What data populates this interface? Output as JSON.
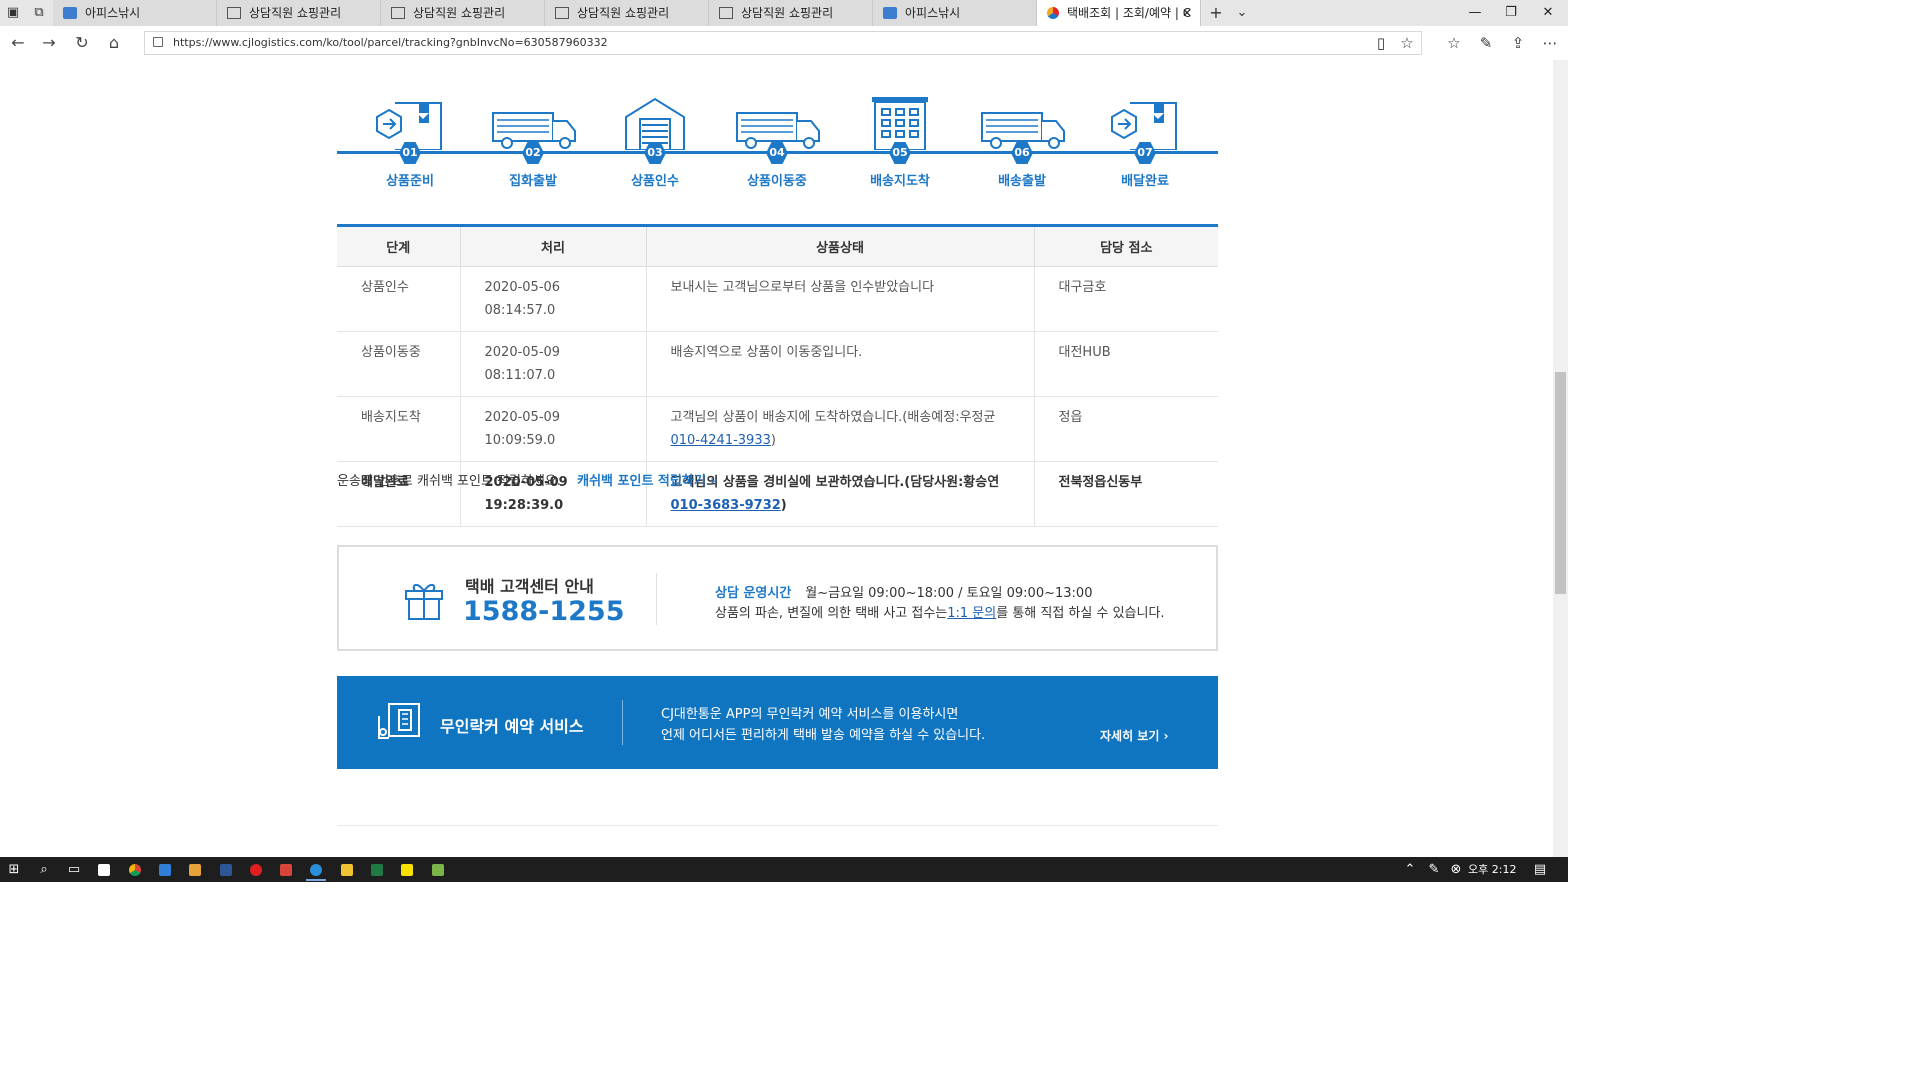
{
  "browser": {
    "tabs": [
      {
        "title": "아피스낚시",
        "icon": "tc",
        "active": false
      },
      {
        "title": "상담직원 쇼핑관리",
        "icon": "page",
        "active": false
      },
      {
        "title": "상담직원 쇼핑관리",
        "icon": "page",
        "active": false
      },
      {
        "title": "상담직원 쇼핑관리",
        "icon": "page",
        "active": false
      },
      {
        "title": "상담직원 쇼핑관리",
        "icon": "page",
        "active": false
      },
      {
        "title": "아피스낚시",
        "icon": "tc",
        "active": false
      },
      {
        "title": "택배조회 | 조회/예약 | C",
        "icon": "cj",
        "active": true
      }
    ],
    "url": "https://www.cjlogistics.com/ko/tool/parcel/tracking?gnbInvcNo=630587960332"
  },
  "steps": [
    {
      "num": "01",
      "label": "상품준비",
      "icon": "box"
    },
    {
      "num": "02",
      "label": "집화출발",
      "icon": "truck"
    },
    {
      "num": "03",
      "label": "상품인수",
      "icon": "warehouse"
    },
    {
      "num": "04",
      "label": "상품이동중",
      "icon": "truck"
    },
    {
      "num": "05",
      "label": "배송지도착",
      "icon": "building"
    },
    {
      "num": "06",
      "label": "배송출발",
      "icon": "truck"
    },
    {
      "num": "07",
      "label": "배달완료",
      "icon": "box"
    }
  ],
  "table": {
    "headers": [
      "단계",
      "처리",
      "상품상태",
      "담당 점소"
    ],
    "rows": [
      {
        "stage": "상품인수",
        "time": "2020-05-06 08:14:57.0",
        "status": "보내시는 고객님으로부터 상품을 인수받았습니다",
        "link": "",
        "suffix": "",
        "branch": "대구금호"
      },
      {
        "stage": "상품이동중",
        "time": "2020-05-09 08:11:07.0",
        "status": "배송지역으로 상품이 이동중입니다.",
        "link": "",
        "suffix": "",
        "branch": "대전HUB"
      },
      {
        "stage": "배송지도착",
        "time": "2020-05-09 10:09:59.0",
        "status": "고객님의 상품이 배송지에 도착하였습니다.(배송예정:우정균 ",
        "link": "010-4241-3933",
        "suffix": ")",
        "branch": "정읍"
      },
      {
        "stage": "배달완료",
        "time": "2020-05-09 19:28:39.0",
        "status": "고객님의 상품을 경비실에 보관하였습니다.(담당사원:황승연 ",
        "link": "010-3683-9732",
        "suffix": ")",
        "branch": "전북정읍신동부"
      }
    ]
  },
  "cashback": {
    "text": "운송장 번호로 캐쉬백 포인트 적립하세요.",
    "link": "캐쉬백 포인트 적립하기 ›"
  },
  "center": {
    "title": "택배 고객센터 안내",
    "phone": "1588-1255",
    "hours_label": "상담 운영시간",
    "hours": "월~금요일 09:00~18:00 / 토요일 09:00~13:00",
    "desc_pre": "상품의 파손, 변질에 의한 택배 사고 접수는",
    "desc_link": "1:1 문의",
    "desc_post": "를 통해 직접 하실 수 있습니다."
  },
  "locker": {
    "title": "무인락커 예약 서비스",
    "line1": "CJ대한통운 APP의 무인락커 예약 서비스를 이용하시면",
    "line2": "언제 어디서든 편리하게 택배 발송 예약을 하실 수 있습니다.",
    "more": "자세히 보기 ›"
  },
  "taskbar": {
    "time": "오후 2:12"
  },
  "colors": {
    "brand_blue": "#1e78c8",
    "banner_blue": "#0f75c1"
  }
}
